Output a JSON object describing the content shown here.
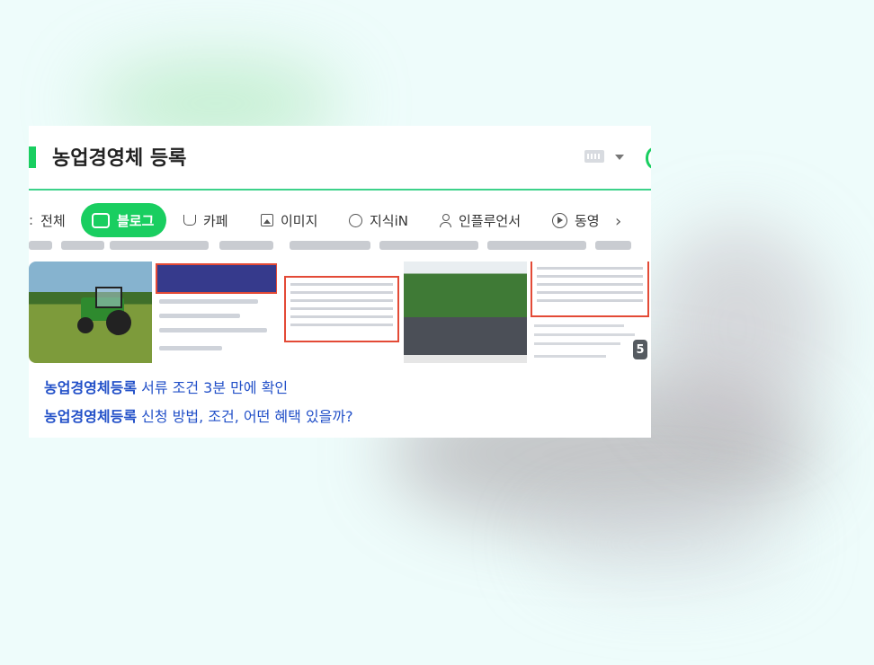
{
  "section": {
    "title": "농업경영체 등록"
  },
  "tabs": [
    {
      "label": "전체",
      "icon": "partial-icon"
    },
    {
      "label": "블로그",
      "icon": "blog-icon",
      "active": true
    },
    {
      "label": "카페",
      "icon": "cafe-cup-icon"
    },
    {
      "label": "이미지",
      "icon": "image-icon"
    },
    {
      "label": "지식iN",
      "icon": "knowledge-q-icon"
    },
    {
      "label": "인플루언서",
      "icon": "person-icon"
    },
    {
      "label": "동영",
      "icon": "play-icon"
    }
  ],
  "gallery": {
    "more_count": "5"
  },
  "results": [
    {
      "keyword": "농업경영체등록",
      "rest": " 서류 조건 3분 만에 확인"
    },
    {
      "keyword": "농업경영체등록",
      "rest": " 신청 방법, 조건, 어떤 혜택 있을까?"
    }
  ],
  "colors": {
    "accent": "#19ce60",
    "link": "#2250c8",
    "highlight_box": "#e34a36"
  }
}
